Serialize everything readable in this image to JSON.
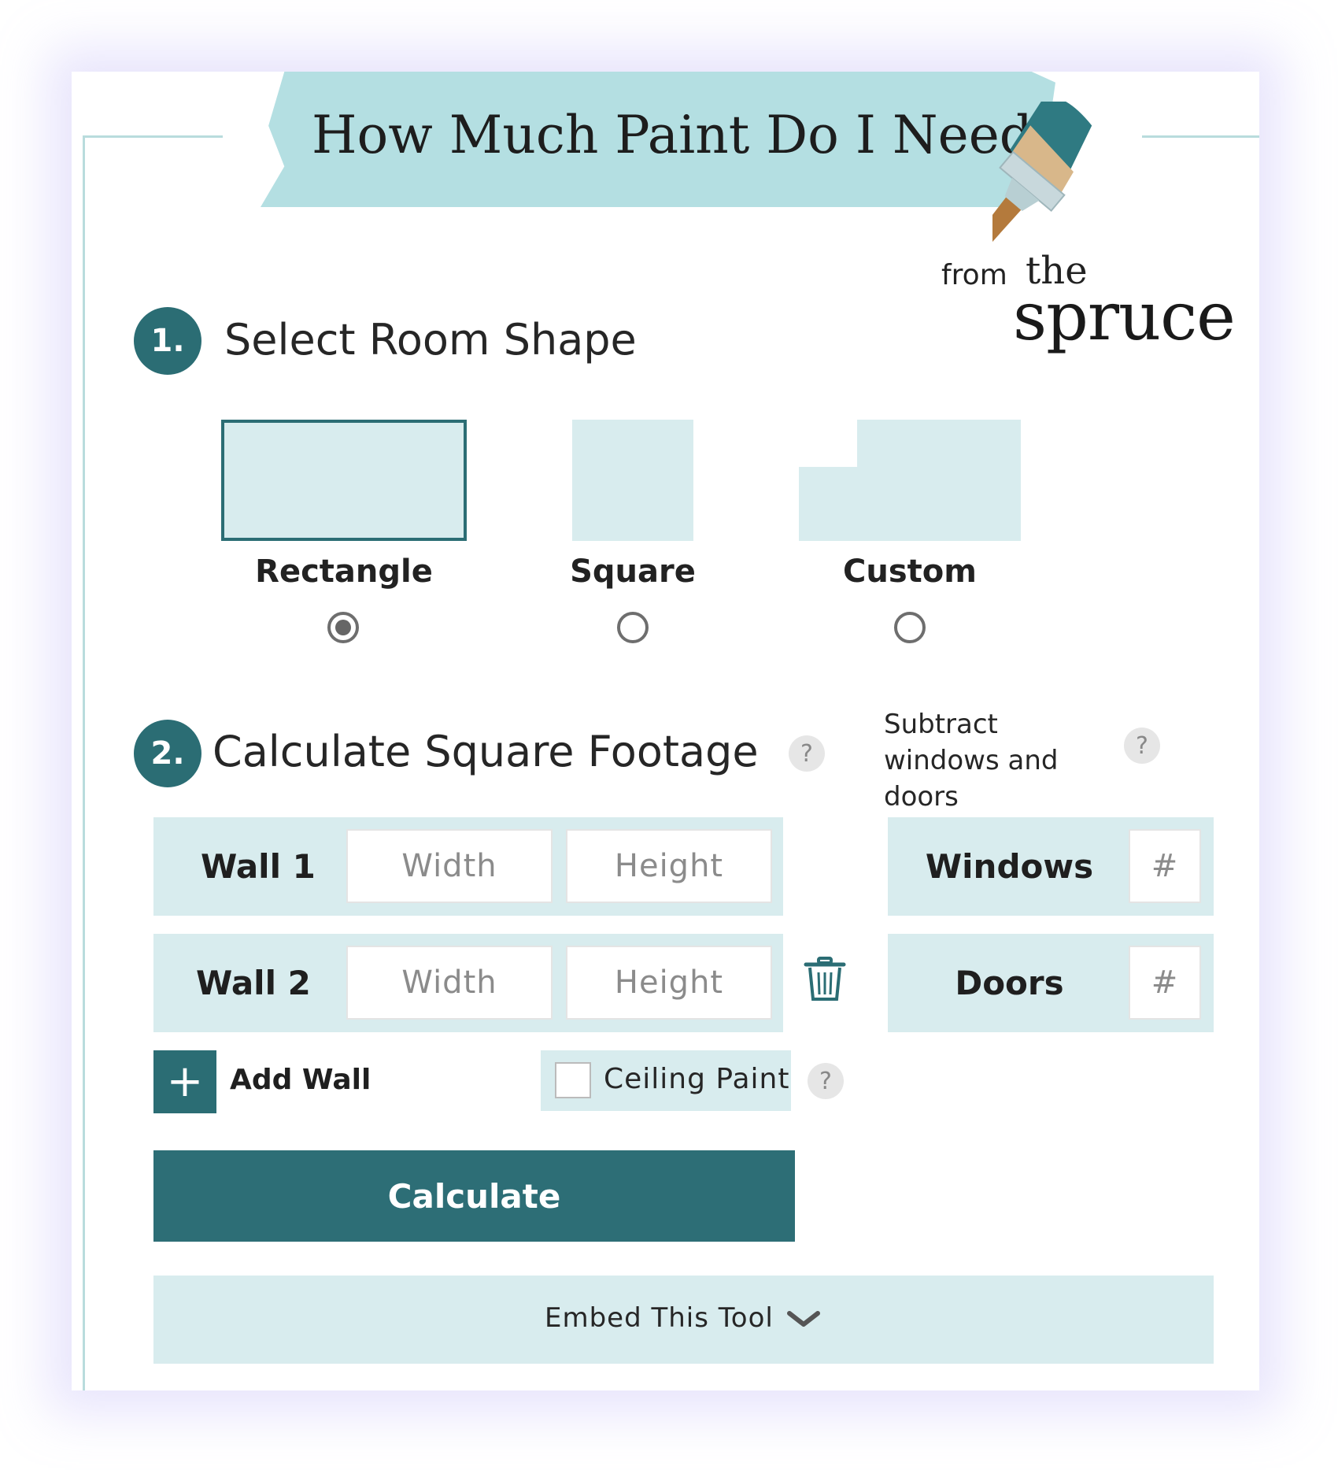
{
  "header": {
    "title": "How Much Paint Do I Need?"
  },
  "brand": {
    "from": "from",
    "the": "the",
    "spruce": "spruce"
  },
  "step1": {
    "number": "1.",
    "title": "Select Room Shape",
    "shapes": [
      {
        "label": "Rectangle",
        "selected": true
      },
      {
        "label": "Square",
        "selected": false
      },
      {
        "label": "Custom",
        "selected": false
      }
    ]
  },
  "step2": {
    "number": "2.",
    "title": "Calculate Square Footage",
    "help": "?",
    "walls": [
      {
        "label": "Wall 1",
        "width_placeholder": "Width",
        "height_placeholder": "Height"
      },
      {
        "label": "Wall 2",
        "width_placeholder": "Width",
        "height_placeholder": "Height"
      }
    ],
    "add_wall": {
      "icon": "+",
      "label": "Add Wall"
    },
    "ceiling": {
      "label": "Ceiling Paint",
      "checked": false,
      "help": "?"
    },
    "calculate_label": "Calculate"
  },
  "subtract": {
    "text": "Subtract windows and doors",
    "help": "?",
    "items": [
      {
        "label": "Windows",
        "placeholder": "#"
      },
      {
        "label": "Doors",
        "placeholder": "#"
      }
    ]
  },
  "embed": {
    "label": "Embed This Tool"
  },
  "colors": {
    "accent": "#2b6d74",
    "light": "#d8ecee",
    "banner": "#b4dfe2"
  }
}
